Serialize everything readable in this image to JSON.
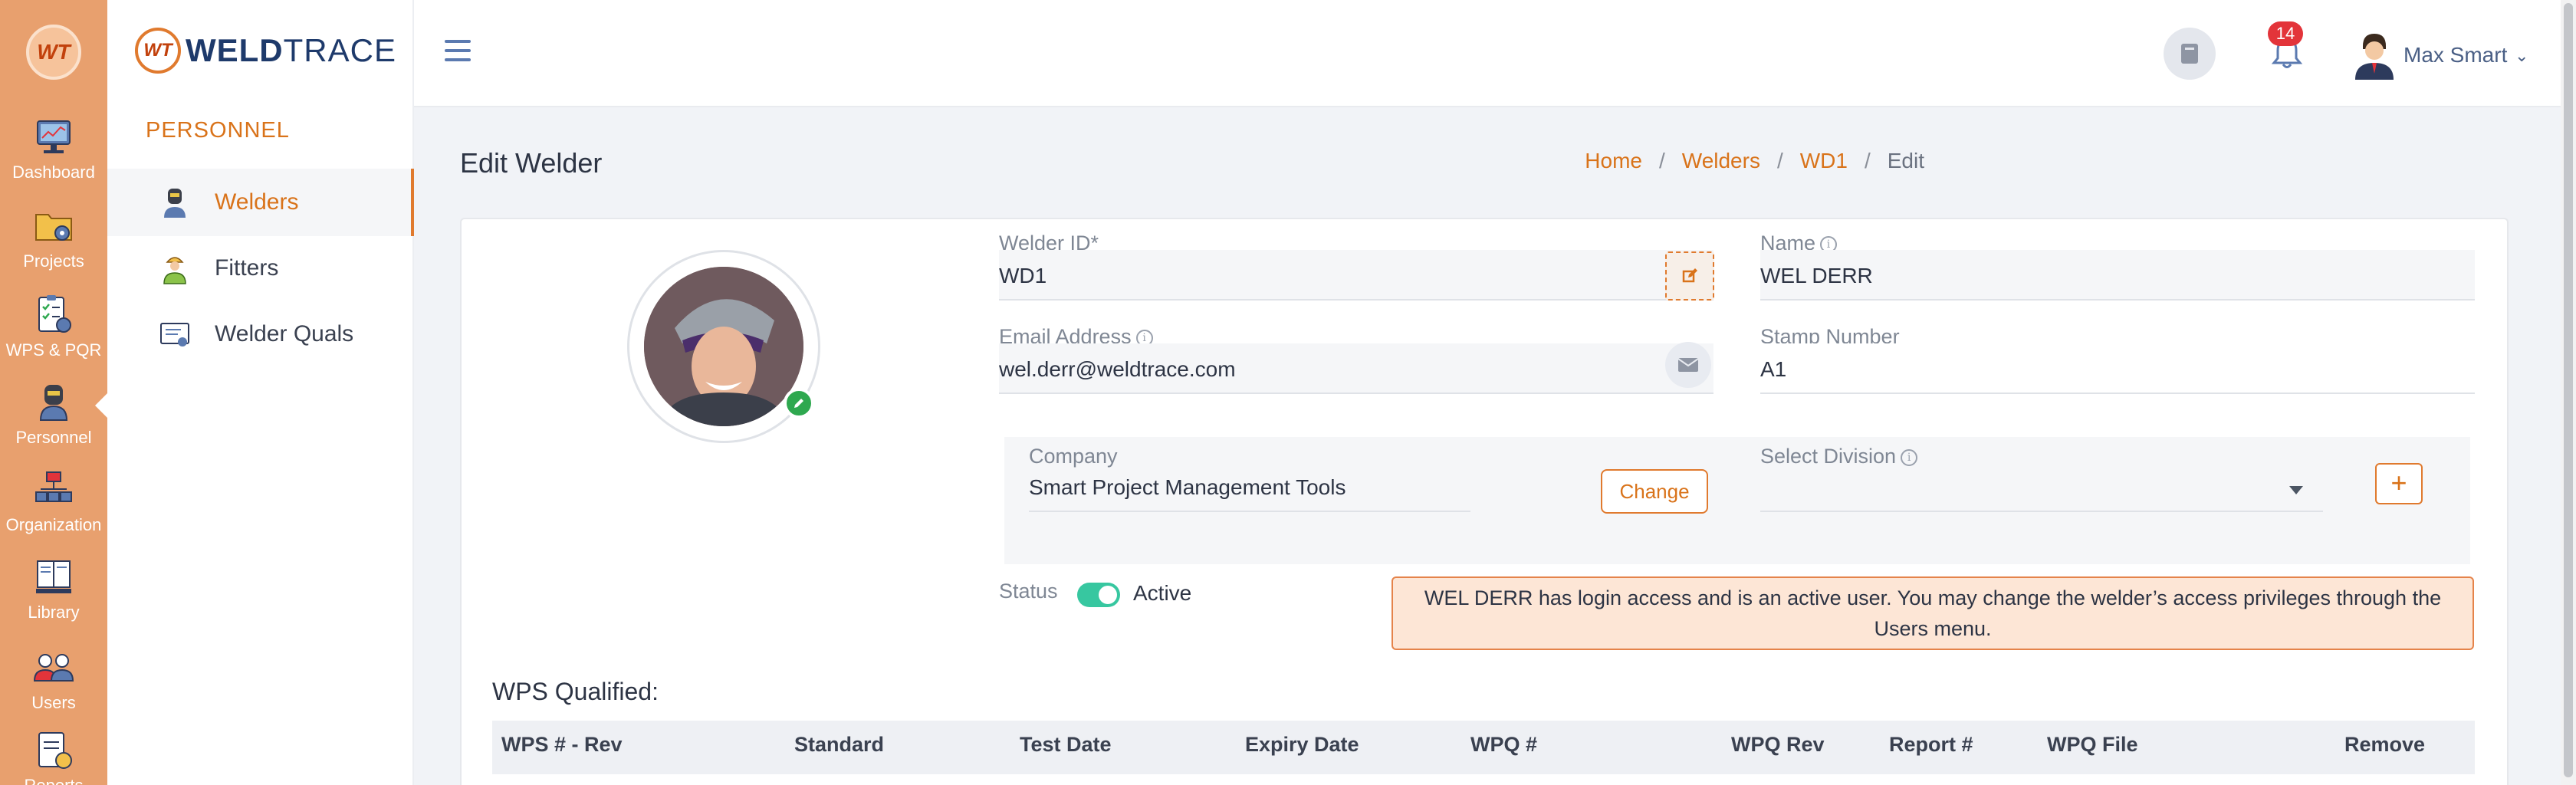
{
  "rail": {
    "logo_text": "WT",
    "items": [
      {
        "label": "Dashboard"
      },
      {
        "label": "Projects"
      },
      {
        "label": "WPS & PQR"
      },
      {
        "label": "Personnel"
      },
      {
        "label": "Organization"
      },
      {
        "label": "Library"
      },
      {
        "label": "Users"
      },
      {
        "label": "Reports"
      }
    ],
    "active": "Personnel"
  },
  "sidebar": {
    "brand_mark": "WT",
    "brand_part1": "WELD",
    "brand_part2": "TRACE",
    "section_title": "PERSONNEL",
    "items": [
      {
        "label": "Welders",
        "icon": "welder-icon"
      },
      {
        "label": "Fitters",
        "icon": "fitter-icon"
      },
      {
        "label": "Welder Quals",
        "icon": "quals-icon"
      }
    ],
    "active": "Welders"
  },
  "topbar": {
    "notification_count": "14",
    "user_name": "Max Smart"
  },
  "page": {
    "title": "Edit Welder",
    "breadcrumb": {
      "home": "Home",
      "welders": "Welders",
      "id": "WD1",
      "current": "Edit",
      "sep": "/"
    }
  },
  "form": {
    "welder_id": {
      "label": "Welder ID*",
      "value": "WD1"
    },
    "name": {
      "label": "Name",
      "value": "WEL DERR"
    },
    "email": {
      "label": "Email Address",
      "value": "wel.derr@weldtrace.com"
    },
    "stamp": {
      "label": "Stamp Number",
      "value": "A1"
    },
    "company": {
      "label": "Company",
      "value": "Smart Project Management Tools",
      "change_label": "Change"
    },
    "division": {
      "label": "Select Division",
      "value": ""
    },
    "status": {
      "label": "Status",
      "value": "Active",
      "on": true
    },
    "notice": "WEL DERR has login access and is an active user. You may change the welder’s access privileges through the Users menu."
  },
  "wps": {
    "heading": "WPS Qualified:",
    "columns": [
      "WPS # - Rev",
      "Standard",
      "Test Date",
      "Expiry Date",
      "WPQ #",
      "WPQ Rev",
      "Report #",
      "WPQ File",
      "Remove"
    ]
  },
  "colors": {
    "accent": "#e07a2e",
    "rail": "#e8a06e",
    "toggle": "#37c7a0",
    "badge": "#e3343a"
  }
}
